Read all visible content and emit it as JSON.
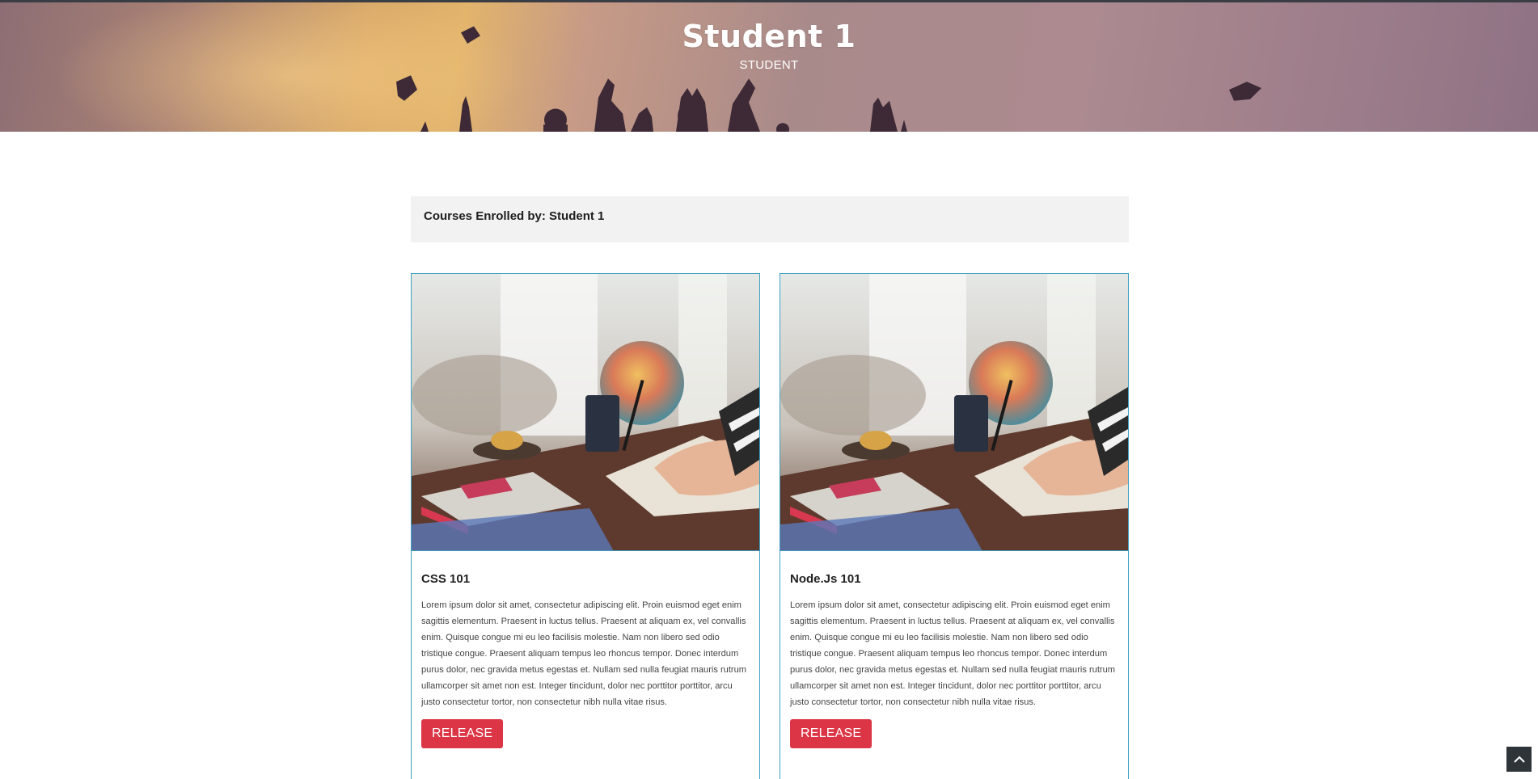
{
  "hero": {
    "title": "Student 1",
    "subtitle": "STUDENT"
  },
  "enrolled": {
    "heading": "Courses Enrolled by: Student 1"
  },
  "courses": [
    {
      "title": "CSS 101",
      "description": "Lorem ipsum dolor sit amet, consectetur adipiscing elit. Proin euismod eget enim sagittis elementum. Praesent in luctus tellus. Praesent at aliquam ex, vel convallis enim. Quisque congue mi eu leo facilisis molestie. Nam non libero sed odio tristique congue. Praesent aliquam tempus leo rhoncus tempor. Donec interdum purus dolor, nec gravida metus egestas et. Nullam sed nulla feugiat mauris rutrum ullamcorper sit amet non est. Integer tincidunt, dolor nec porttitor porttitor, arcu justo consectetur tortor, non consectetur nibh nulla vitae risus.",
      "button": "RELEASE"
    },
    {
      "title": "Node.Js 101",
      "description": "Lorem ipsum dolor sit amet, consectetur adipiscing elit. Proin euismod eget enim sagittis elementum. Praesent in luctus tellus. Praesent at aliquam ex, vel convallis enim. Quisque congue mi eu leo facilisis molestie. Nam non libero sed odio tristique congue. Praesent aliquam tempus leo rhoncus tempor. Donec interdum purus dolor, nec gravida metus egestas et. Nullam sed nulla feugiat mauris rutrum ullamcorper sit amet non est. Integer tincidunt, dolor nec porttitor porttitor, arcu justo consectetur tortor, non consectetur nibh nulla vitae risus.",
      "button": "RELEASE"
    }
  ],
  "icons": {
    "scroll_top": "chevron-up-icon"
  },
  "colors": {
    "release_button": "#dc3545",
    "card_border": "#3da0c0",
    "enrolled_bar_bg": "#f2f2f2"
  }
}
